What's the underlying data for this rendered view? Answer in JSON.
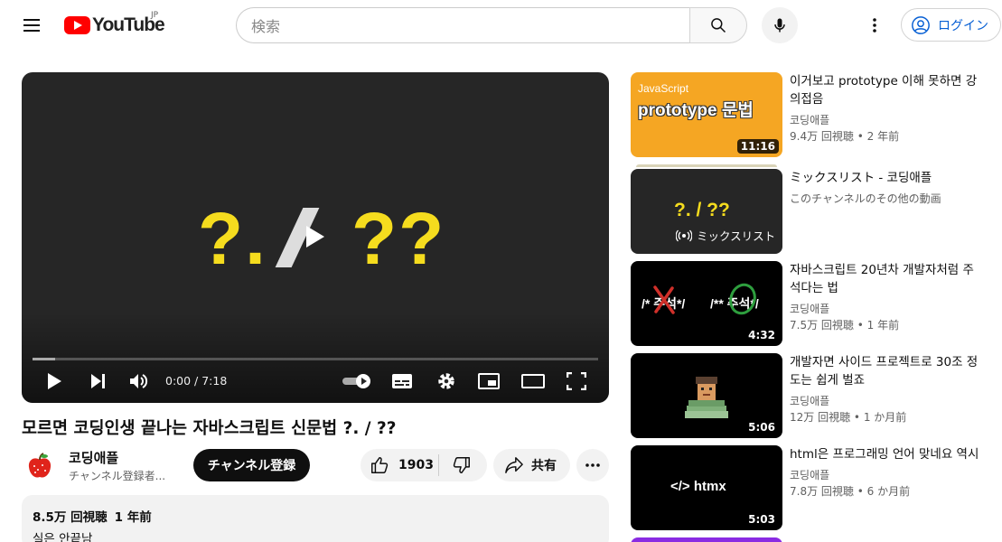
{
  "header": {
    "logo_text": "YouTube",
    "country": "JP",
    "search_placeholder": "検索",
    "login_label": "ログイン"
  },
  "player": {
    "thumb_left": "?.",
    "thumb_right": "??",
    "time": "0:00 / 7:18",
    "progress": 0.04
  },
  "video": {
    "title": "모르면 코딩인생 끝나는 자바스크립트 신문법 ?. / ??",
    "channel": "코딩애플",
    "subscribers": "チャンネル登録者...",
    "subscribe_label": "チャンネル登録",
    "likes": "1903",
    "share_label": "共有",
    "views": "8.5万 回視聴",
    "uploaded": "1 年前",
    "description": "실은 안끝남"
  },
  "sidebar": {
    "items": [
      {
        "title": "이거보고 prototype 이해 못하면 강의접음",
        "channel": "코딩애플",
        "views": "9.4万 回視聴",
        "age": "2 年前",
        "duration": "11:16",
        "thumb_top": "JavaScript",
        "thumb_main": "prototype 문법"
      },
      {
        "title": "ミックスリスト - 코딩애플",
        "channel": "このチャンネルのその他の動画",
        "thumb_main": "?. / ??",
        "thumb_badge": "ミックスリスト"
      },
      {
        "title": "자바스크립트 20년차 개발자처럼 주석다는 법",
        "channel": "코딩애플",
        "views": "7.5万 回視聴",
        "age": "1 年前",
        "duration": "4:32",
        "thumb_left": "/* 주석*/",
        "thumb_right": "/** 주석*/"
      },
      {
        "title": "개발자면 사이드 프로젝트로 30조 정도는 쉽게 벌죠",
        "channel": "코딩애플",
        "views": "12万 回視聴",
        "age": "1 か月前",
        "duration": "5:06"
      },
      {
        "title": "html은 프로그래밍 언어 맞네요 역시",
        "channel": "코딩애플",
        "views": "7.8万 回視聴",
        "age": "6 か月前",
        "duration": "5:03",
        "thumb_main": "</> htmx"
      }
    ]
  },
  "colors": {
    "brand_red": "#ff0000",
    "link_blue": "#065fd4",
    "thumb_yellow": "#f5dc1e",
    "thumb_orange": "#f5a623"
  }
}
